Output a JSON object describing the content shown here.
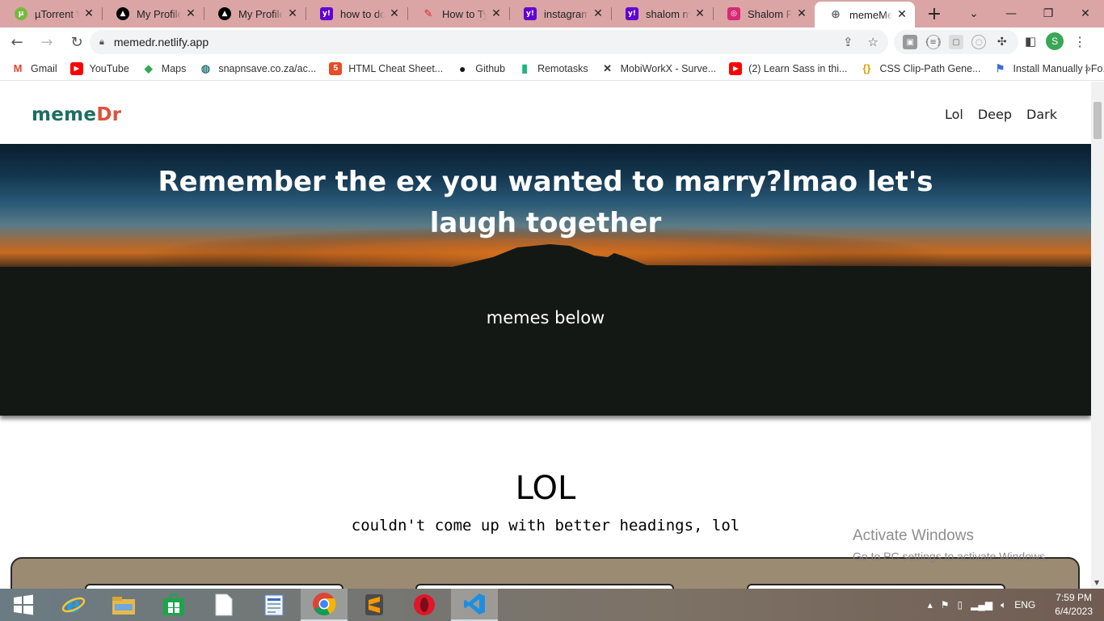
{
  "browser": {
    "tabs": [
      {
        "title": "µTorrent Web",
        "icon": "utorrent-icon",
        "color": "#76b83f",
        "glyph": "µ"
      },
      {
        "title": "My Profile",
        "icon": "triangle-logo-icon",
        "color": "#000000",
        "glyph": "▲"
      },
      {
        "title": "My Profile",
        "icon": "triangle-logo-icon",
        "color": "#000000",
        "glyph": "▲"
      },
      {
        "title": "how to do l",
        "icon": "yahoo-icon",
        "color": "#6001d2",
        "glyph": "y!"
      },
      {
        "title": "How to Typ",
        "icon": "pen-logo-icon",
        "color": "#d9232e",
        "glyph": "✎"
      },
      {
        "title": "instagram -",
        "icon": "yahoo-icon",
        "color": "#6001d2",
        "glyph": "y!"
      },
      {
        "title": "shalom nya",
        "icon": "yahoo-icon",
        "color": "#6001d2",
        "glyph": "y!"
      },
      {
        "title": "Shalom Phi",
        "icon": "instagram-icon",
        "color": "#d62976",
        "glyph": "◎"
      },
      {
        "title": "memeMe",
        "icon": "globe-icon",
        "color": "#5f6368",
        "glyph": "⊕",
        "active": true
      }
    ],
    "new_tab_glyph": "+",
    "close_glyph": "✕",
    "url": "memedr.netlify.app",
    "profile_initial": "S",
    "bookmarks": [
      {
        "label": "Gmail",
        "icon": "gmail-icon",
        "color": "#ea4335",
        "glyph": "M"
      },
      {
        "label": "YouTube",
        "icon": "youtube-icon",
        "color": "#ff0000",
        "glyph": "▶"
      },
      {
        "label": "Maps",
        "icon": "maps-icon",
        "color": "#34a853",
        "glyph": "◆"
      },
      {
        "label": "snapnsave.co.za/ac...",
        "icon": "snapnsave-icon",
        "color": "#2a7a7a",
        "glyph": "◍"
      },
      {
        "label": "HTML Cheat Sheet...",
        "icon": "html-icon",
        "color": "#e44d26",
        "glyph": "5"
      },
      {
        "label": "Github",
        "icon": "github-icon",
        "color": "#181717",
        "glyph": "●"
      },
      {
        "label": "Remotasks",
        "icon": "remotasks-icon",
        "color": "#1fb67e",
        "glyph": "▮"
      },
      {
        "label": "MobiWorkX - Surve...",
        "icon": "mobiworkx-icon",
        "color": "#333333",
        "glyph": "✕"
      },
      {
        "label": "(2) Learn Sass in thi...",
        "icon": "youtube-icon",
        "color": "#ff0000",
        "glyph": "▶"
      },
      {
        "label": "CSS Clip-Path Gene...",
        "icon": "css-icon",
        "color": "#e0a000",
        "glyph": "{}"
      },
      {
        "label": "Install Manually | Fo...",
        "icon": "flag-icon",
        "color": "#3b6fd8",
        "glyph": "⚑"
      }
    ]
  },
  "site": {
    "logo_part1": "meme",
    "logo_part2": "Dr",
    "nav": [
      "Lol",
      "Deep",
      "Dark"
    ],
    "hero_title": "Remember the ex you wanted to marry?lmao let's laugh together",
    "hero_subtitle": "memes below",
    "section_title": "LOL",
    "section_subtitle": "couldn't come up with better headings, lol",
    "colors": {
      "logo_meme": "#1d6e62",
      "logo_dr": "#e0503b",
      "panel": "#9b8b73"
    }
  },
  "watermark": {
    "line1": "Activate Windows",
    "line2": "Go to PC settings to activate Windows."
  },
  "taskbar": {
    "apps": [
      "windows-start-icon",
      "internet-explorer-icon",
      "file-explorer-icon",
      "store-icon",
      "document-icon",
      "wordpad-icon",
      "chrome-icon",
      "sublime-text-icon",
      "opera-icon",
      "vscode-icon"
    ],
    "language": "ENG",
    "time": "7:59 PM",
    "date": "6/4/2023"
  }
}
